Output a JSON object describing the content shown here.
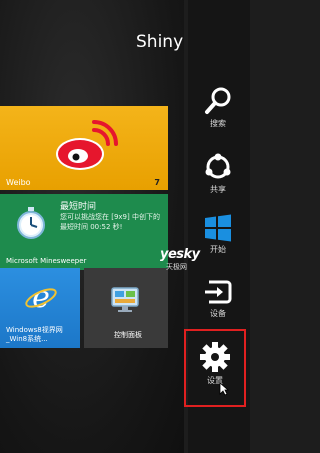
{
  "user": {
    "name": "Shiny"
  },
  "tiles": {
    "weibo": {
      "name": "Weibo",
      "badge": "7"
    },
    "minesweeper": {
      "title": "最短时间",
      "body": "您可以挑战您在 [9x9] 中创下的最短时间 00:52 秒!",
      "name": "Microsoft Minesweeper"
    },
    "ie": {
      "label": "Windows8视界网_Win8系统..."
    },
    "control_panel": {
      "label": "控制面板"
    }
  },
  "charms": {
    "search": "搜索",
    "share": "共享",
    "start": "开始",
    "devices": "设备",
    "settings": "设置"
  },
  "watermark": {
    "main": "yesky",
    "sub": "天极网"
  },
  "colors": {
    "weibo_tile": "#f4b41a",
    "minesweeper_tile": "#1e8b4d",
    "ie_tile": "#2c8fe0",
    "control_panel_tile": "#3a3a3a",
    "charm_bar": "#151515",
    "highlight_border": "#e02020",
    "start_logo": "#1a8fe0"
  }
}
